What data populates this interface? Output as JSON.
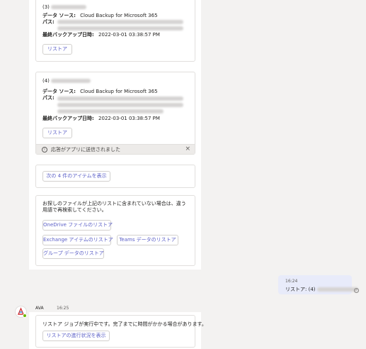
{
  "result3": {
    "header": "(3)",
    "source_label": "データ ソース:",
    "source_value": "Cloud Backup for Microsoft 365",
    "path_label": "パス:",
    "last_backup_label": "最終バックアップ日時:",
    "last_backup_value": "2022-03-01 03:38:57 PM",
    "restore_button": "リストア"
  },
  "result4": {
    "header": "(4)",
    "source_label": "データ ソース:",
    "source_value": "Cloud Backup for Microsoft 365",
    "path_label": "パス:",
    "last_backup_label": "最終バックアップ日時:",
    "last_backup_value": "2022-03-01 03:38:57 PM",
    "restore_button": "リストア",
    "notice_text": "応答がアプリに送信されました"
  },
  "show_more": {
    "button": "次の 4 件のアイテムを表示"
  },
  "not_found": {
    "text": "お探しのファイルが上記のリストに含まれていない場合は、違う用語で再検索してください。",
    "buttons": {
      "onedrive": "OneDrive ファイルのリストア",
      "exchange": "Exchange アイテムのリストア",
      "teams": "Teams データのリストア",
      "group": "グループ データのリストア"
    }
  },
  "user_message": {
    "time": "16:24",
    "text": "リストア: (4)"
  },
  "bot_message": {
    "sender": "AVA",
    "time": "16:25",
    "text": "リストア ジョブが実行中です。完了までに時間がかかる場合があります。",
    "button": "リストアの進行状況を表示"
  },
  "colors": {
    "accent": "#5b5fc7",
    "page_background": "#f3f2f1",
    "user_bubble": "#e8ebfa",
    "presence": "#6bb700"
  },
  "icons": {
    "notice": "info-icon",
    "notice_close": "close-icon",
    "read_receipt": "check-circle-icon"
  }
}
